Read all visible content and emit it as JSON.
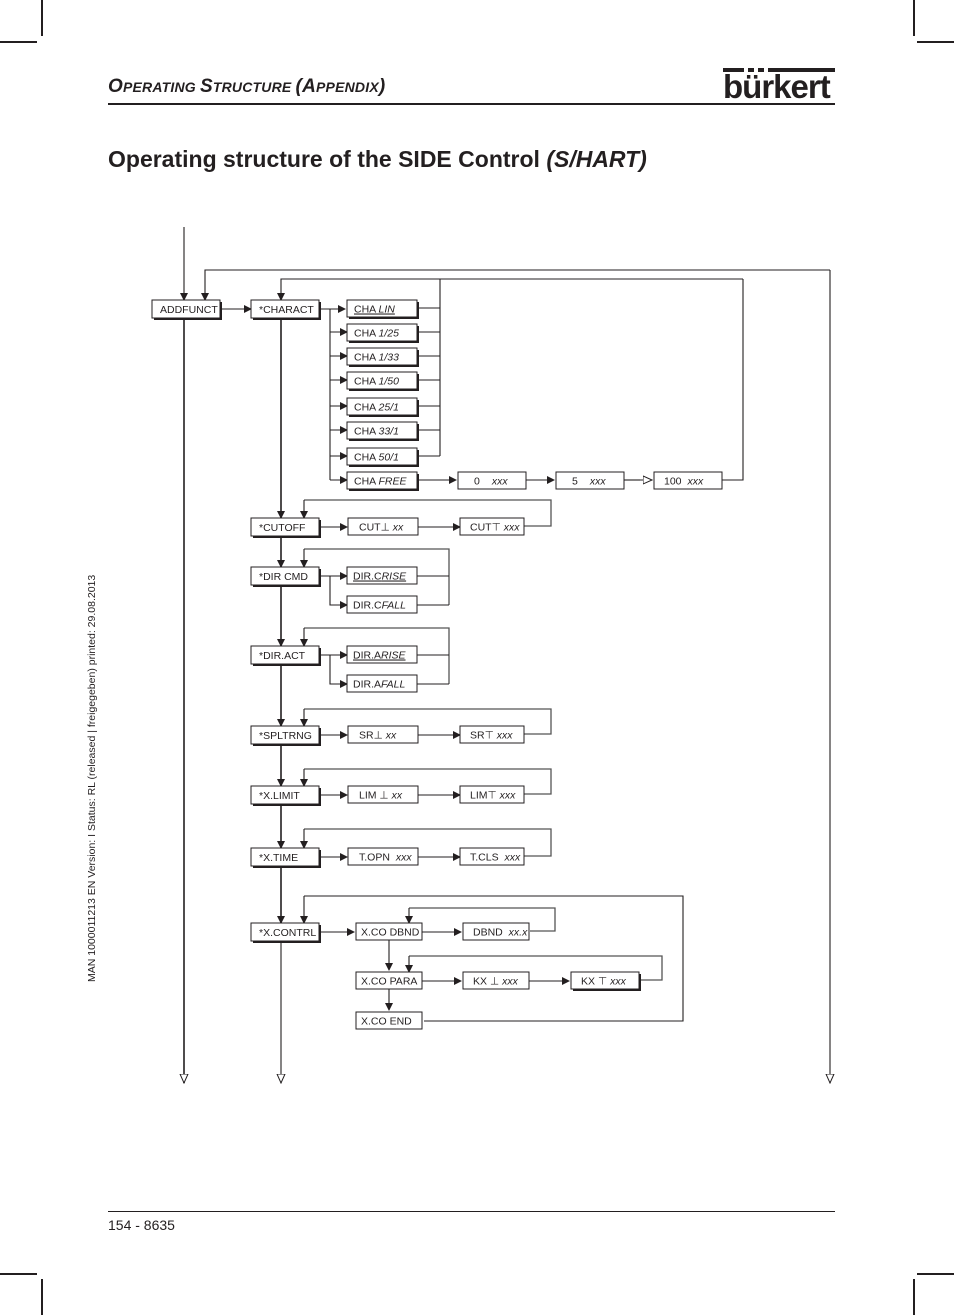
{
  "header": {
    "section_title_parts": [
      {
        "cap": "O",
        "rest": "PERATING "
      },
      {
        "cap": "S",
        "rest": "TRUCTURE "
      },
      {
        "cap": "(A",
        "rest": "PPENDIX"
      },
      {
        "cap": ")",
        "rest": ""
      }
    ],
    "logo": "bürkert"
  },
  "page_title": "Operating structure of the SIDE Control",
  "page_title_italic": "(S/HART)",
  "side_note": "MAN  1000011213  EN  Version: I  Status: RL (released | freigegeben)  printed: 29.08.2013",
  "footer": {
    "page": "154  -  8635"
  },
  "diagram": {
    "root": {
      "label": "ADDFUNCT"
    },
    "menus": [
      {
        "id": "charact",
        "label": "*CHARACT",
        "options": [
          {
            "prefix": "CHA ",
            "value": "LIN",
            "default": true
          },
          {
            "prefix": "CHA ",
            "value": "1/25"
          },
          {
            "prefix": "CHA ",
            "value": "1/33"
          },
          {
            "prefix": "CHA ",
            "value": "1/50"
          },
          {
            "prefix": "CHA ",
            "value": "25/1"
          },
          {
            "prefix": "CHA ",
            "value": "33/1"
          },
          {
            "prefix": "CHA ",
            "value": "50/1"
          },
          {
            "prefix": "CHA ",
            "value": "FREE"
          }
        ],
        "free_points": [
          {
            "prefix": "0",
            "value": "xxx"
          },
          {
            "prefix": "5",
            "value": "xxx"
          },
          {
            "prefix": "100",
            "value": "xxx"
          }
        ]
      },
      {
        "id": "cutoff",
        "label": "*CUTOFF",
        "steps": [
          {
            "prefix": "CUT",
            "sym": "⊥",
            "value": "xx"
          },
          {
            "prefix": "CUT",
            "sym": "⊤",
            "value": "xxx"
          }
        ]
      },
      {
        "id": "dircmd",
        "label": "*DIR CMD",
        "options": [
          {
            "prefix": "DIR.C",
            "value": "RISE",
            "default": true
          },
          {
            "prefix": "DIR.C",
            "value": "FALL"
          }
        ]
      },
      {
        "id": "diract",
        "label": "*DIR.ACT",
        "options": [
          {
            "prefix": "DIR.A",
            "value": "RISE",
            "default": true
          },
          {
            "prefix": "DIR.A",
            "value": "FALL"
          }
        ]
      },
      {
        "id": "spltrng",
        "label": "*SPLTRNG",
        "steps": [
          {
            "prefix": "SR",
            "sym": "⊥",
            "value": "xx"
          },
          {
            "prefix": "SR",
            "sym": "⊤",
            "value": "xxx"
          }
        ]
      },
      {
        "id": "xlimit",
        "label": "*X.LIMIT",
        "steps": [
          {
            "prefix": "LIM ",
            "sym": "⊥",
            "value": "xx"
          },
          {
            "prefix": "LIM",
            "sym": "⊤",
            "value": "xxx"
          }
        ]
      },
      {
        "id": "xtime",
        "label": "*X.TIME",
        "steps": [
          {
            "prefix": "T.OPN ",
            "sym": "",
            "value": "xxx"
          },
          {
            "prefix": "T.CLS ",
            "sym": "",
            "value": "xxx"
          }
        ]
      },
      {
        "id": "xcontrl",
        "label": "*X.CONTRL",
        "sub": [
          {
            "label": "X.CO DBND",
            "steps": [
              {
                "prefix": "DBND ",
                "sym": "",
                "value": "xx.x"
              }
            ]
          },
          {
            "label": "X.CO PARA",
            "steps": [
              {
                "prefix": "KX ",
                "sym": "⊥",
                "value": "xxx"
              },
              {
                "prefix": "KX ",
                "sym": "⊤",
                "value": "xxx"
              }
            ]
          },
          {
            "label": "X.CO END"
          }
        ]
      }
    ]
  }
}
